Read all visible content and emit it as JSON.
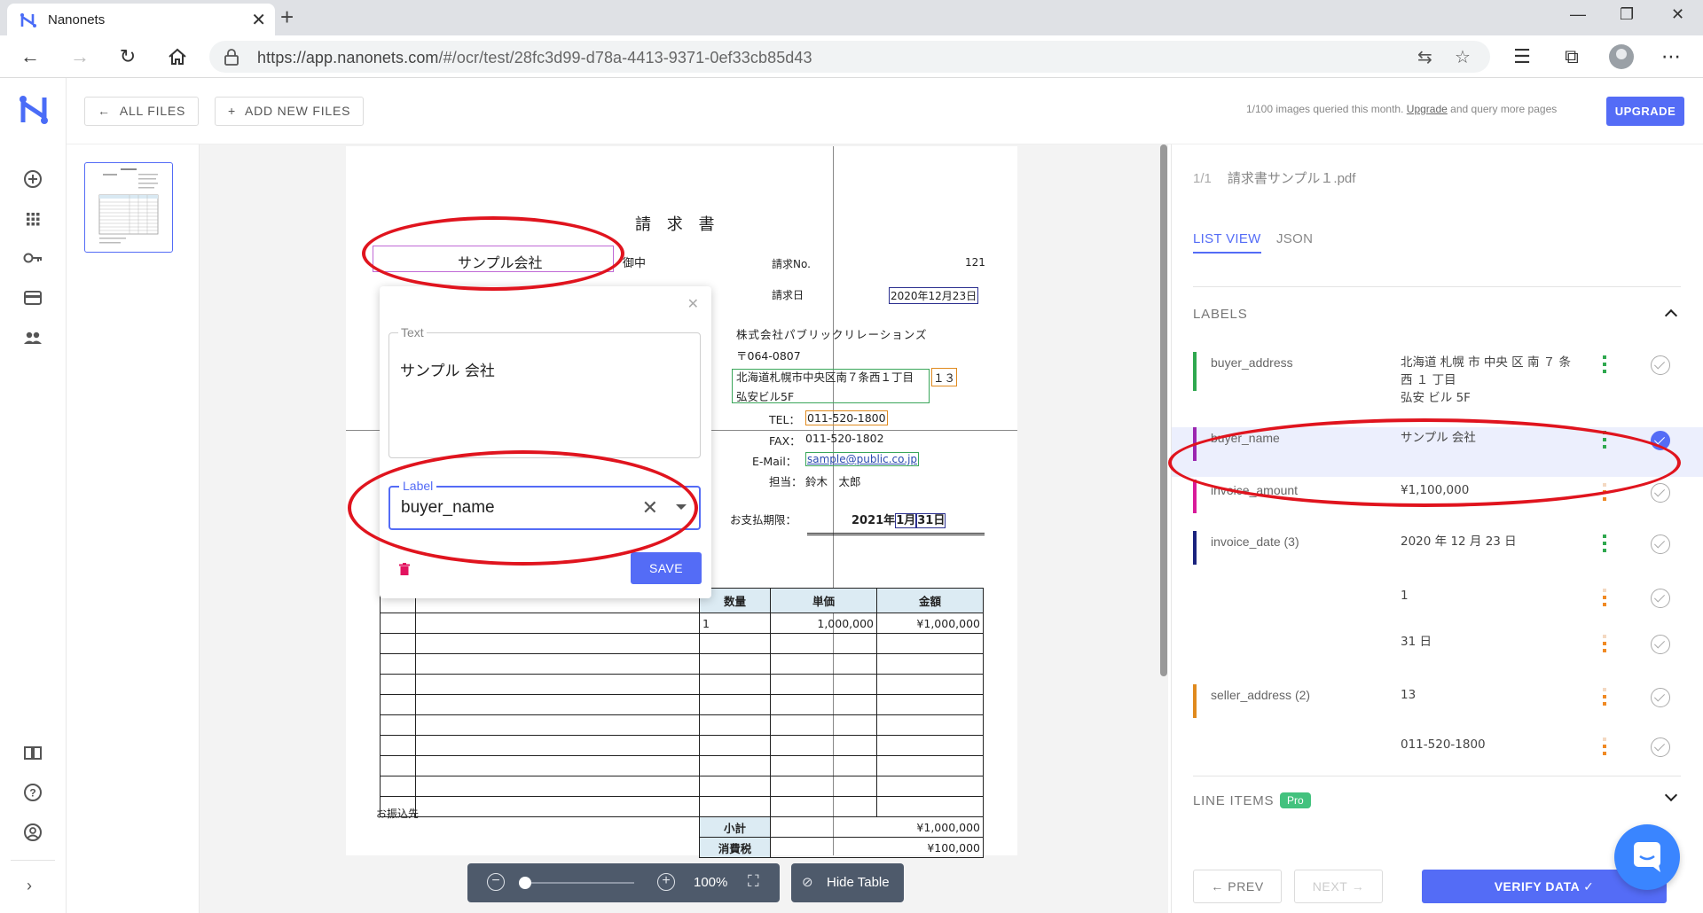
{
  "browser": {
    "tab_title": "Nanonets",
    "url_host": "https://app.nanonets.com",
    "url_path": "/#/ocr/test/28fc3d99-d78a-4413-9371-0ef33cb85d43"
  },
  "toolbar": {
    "all_files": "ALL FILES",
    "add_new_files": "ADD NEW FILES",
    "quota_prefix": "1/100 images queried this month.",
    "quota_link": "Upgrade",
    "quota_suffix": "and query more pages",
    "upgrade": "UPGRADE"
  },
  "document": {
    "title": "請 求 書",
    "buyer_name": "サンプル会社",
    "onchu": "御中",
    "invoice_no_label": "請求No.",
    "invoice_no": "121",
    "invoice_date_label": "請求日",
    "invoice_date": "2020年12月23日",
    "seller_company": "株式会社パブリックリレーションズ",
    "seller_postal": "〒064-0807",
    "seller_address1": "北海道札幌市中央区南７条西１丁目",
    "seller_address1_num": "１３",
    "seller_address2": "弘安ビル5F",
    "tel_label": "TEL：",
    "tel": "011-520-1800",
    "fax_label": "FAX：",
    "fax": "011-520-1802",
    "email_label": "E-Mail：",
    "email": "sample@public.co.jp",
    "person_label": "担当：",
    "person": "鈴木　太郎",
    "due_label": "お支払期限：",
    "due_prefix": "2021年",
    "due_month": "1月",
    "due_day": "31日",
    "col_qty": "数量",
    "col_price": "単価",
    "col_amount": "金額",
    "row1_qty": "1",
    "row1_price": "1,000,000",
    "row1_amount": "¥1,000,000",
    "subtotal_label": "小計",
    "subtotal": "¥1,000,000",
    "tax_label": "消費税",
    "tax": "¥100,000",
    "bank_label": "お振込先"
  },
  "popup": {
    "text_legend": "Text",
    "text_value": "サンプル 会社",
    "label_legend": "Label",
    "label_value": "buyer_name",
    "save": "SAVE"
  },
  "zoom": {
    "level": "100%",
    "hide_table": "Hide Table"
  },
  "panel": {
    "page_count": "1/1",
    "file_name": "請求書サンプル１.pdf",
    "tab_list": "LIST VIEW",
    "tab_json": "JSON",
    "labels_header": "LABELS",
    "line_items_header": "LINE ITEMS",
    "pro_badge": "Pro",
    "prev": "PREV",
    "next": "NEXT",
    "verify": "VERIFY DATA",
    "rows": [
      {
        "name": "buyer_address",
        "value_lines": [
          "北海道 札幌 市 中央 区 南 ７ 条",
          "西 １ 丁目",
          "弘安 ビル 5F"
        ],
        "color": "#2fa84f",
        "dots": "#2fa84f"
      },
      {
        "name": "buyer_name",
        "value_lines": [
          "サンプル 会社"
        ],
        "color": "#9b27b0",
        "dots": "#2fa84f"
      },
      {
        "name": "invoice_amount",
        "value_lines": [
          "¥1,100,000"
        ],
        "color": "#d81b9a",
        "dots": "#f08a24"
      },
      {
        "name": "invoice_date (3)",
        "value_lines": [
          "2020 年 12 月 23 日"
        ],
        "color": "#1a237e",
        "dots": "#2fa84f"
      },
      {
        "name": "",
        "value_lines": [
          "1"
        ],
        "color": "",
        "dots": "#f08a24"
      },
      {
        "name": "",
        "value_lines": [
          "31 日"
        ],
        "color": "",
        "dots": "#f08a24"
      },
      {
        "name": "seller_address (2)",
        "value_lines": [
          "13"
        ],
        "color": "#e08a1e",
        "dots": "#f08a24"
      },
      {
        "name": "",
        "value_lines": [
          "011-520-1800"
        ],
        "color": "",
        "dots": "#f08a24"
      }
    ]
  },
  "colors": {
    "accent": "#546cf6",
    "highlight_red": "#e0141e"
  }
}
